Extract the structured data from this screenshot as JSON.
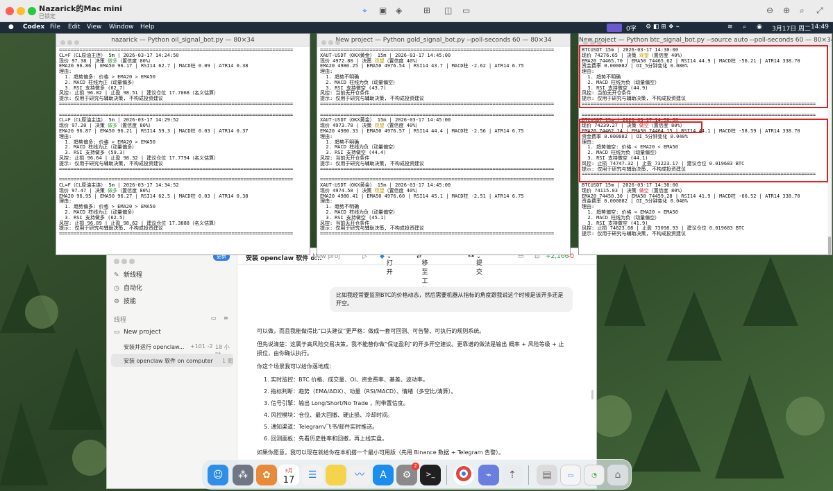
{
  "viewer": {
    "title": "Nazarick的Mac mini",
    "subtitle": "已锁定"
  },
  "menubar": {
    "app": "Codex",
    "items": [
      "File",
      "Edit",
      "View",
      "Window",
      "Help"
    ],
    "status_text": "0字",
    "date": "3月17日 周二",
    "time": "14:49"
  },
  "terminals": [
    {
      "title": "nazarick — Python oil_signal_bot.py — 80×34",
      "lines": [
        [
          [
            "================================================================================",
            "n"
          ]
        ],
        [
          [
            "CL=F（CL原油主连） 5m | 2026-03-17 14:24:50",
            "n"
          ]
        ],
        [
          [
            "现价 97.38 | 决策 ",
            "n"
          ],
          [
            "做多",
            "g"
          ],
          [
            "（置信度 80%）",
            "n"
          ]
        ],
        [
          [
            "EMA20 96.86 | EMA50 96.17 | RSI14 62.7 | MACD柱 0.09 | ATR14 0.38",
            "n"
          ]
        ],
        [
          [
            "理由:",
            "n"
          ]
        ],
        [
          [
            "  1. 趋势偏多: 价格 > EMA20 > EMA50",
            "n"
          ]
        ],
        [
          [
            "  2. MACD 柱线为正（动量偏多）",
            "n"
          ]
        ],
        [
          [
            "  3. RSI 支持做多 (62.7)",
            "n"
          ]
        ],
        [
          [
            "风控: 止损 96.82 | 止盈 98.51 | 建议仓位 17.7068（名义估算）",
            "n"
          ]
        ],
        [
          [
            "提示: 仅用于研究与辅助决策, 不构成投资建议",
            "n"
          ]
        ],
        [
          [
            "================================================================================",
            "n"
          ]
        ],
        [
          [
            "",
            "n"
          ]
        ],
        [
          [
            "================================================================================",
            "n"
          ]
        ],
        [
          [
            "CL=F（CL原油主连） 5m | 2026-03-17 14:29:52",
            "n"
          ]
        ],
        [
          [
            "现价 97.20 | 决策 ",
            "n"
          ],
          [
            "做多",
            "g"
          ],
          [
            "（置信度 80%）",
            "n"
          ]
        ],
        [
          [
            "EMA20 96.87 | EMA50 96.21 | RSI14 59.3 | MACD柱 0.03 | ATR14 0.37",
            "n"
          ]
        ],
        [
          [
            "理由:",
            "n"
          ]
        ],
        [
          [
            "  1. 趋势偏多: 价格 > EMA20 > EMA50",
            "n"
          ]
        ],
        [
          [
            "  2. MACD 柱线为正（动量偏多）",
            "n"
          ]
        ],
        [
          [
            "  3. RSI 支持做多 (59.3)",
            "n"
          ]
        ],
        [
          [
            "风控: 止损 96.64 | 止盈 98.32 | 建议仓位 17.7794（名义估算）",
            "n"
          ]
        ],
        [
          [
            "提示: 仅用于研究与辅助决策, 不构成投资建议",
            "n"
          ]
        ],
        [
          [
            "================================================================================",
            "n"
          ]
        ],
        [
          [
            "",
            "n"
          ]
        ],
        [
          [
            "================================================================================",
            "n"
          ]
        ],
        [
          [
            "CL=F（CL原油主连） 5m | 2026-03-17 14:34:52",
            "n"
          ]
        ],
        [
          [
            "现价 97.47 | 决策 ",
            "n"
          ],
          [
            "做多",
            "g"
          ],
          [
            "（置信度 80%）",
            "n"
          ]
        ],
        [
          [
            "EMA20 96.95 | EMA50 96.27 | RSI14 62.5 | MACD柱 0.03 | ATR14 0.38",
            "n"
          ]
        ],
        [
          [
            "理由:",
            "n"
          ]
        ],
        [
          [
            "  1. 趋势偏多: 价格 > EMA20 > EMA50",
            "n"
          ]
        ],
        [
          [
            "  2. MACD 柱线为正（动量偏多）",
            "n"
          ]
        ],
        [
          [
            "  3. RSI 支持做多 (62.5)",
            "n"
          ]
        ],
        [
          [
            "风控: 止损 96.89 | 止盈 98.62 | 建议仓位 17.3888（名义估算）",
            "n"
          ]
        ],
        [
          [
            "提示: 仅用于研究与辅助决策, 不构成投资建议",
            "n"
          ]
        ],
        [
          [
            "================================================================================",
            "n"
          ]
        ]
      ]
    },
    {
      "title": "New project — Python gold_signal_bot.py --poll-seconds 60 — 80×34",
      "lines": [
        [
          [
            "================================================================================",
            "n"
          ]
        ],
        [
          [
            "XAUT-USDT（OKX黄金） 15m | 2026-03-17 14:45:00",
            "n"
          ]
        ],
        [
          [
            "现价 4972.80 | 决策 ",
            "n"
          ],
          [
            "观望",
            "y"
          ],
          [
            "（置信度 40%）",
            "n"
          ]
        ],
        [
          [
            "EMA20 4980.25 | EMA50 4976.54 | RSI14 43.7 | MACD柱 -2.62 | ATR14 6.75",
            "n"
          ]
        ],
        [
          [
            "理由:",
            "n"
          ]
        ],
        [
          [
            "  1. 趋势不明确",
            "n"
          ]
        ],
        [
          [
            "  2. MACD 柱线为负（动量偏空）",
            "n"
          ]
        ],
        [
          [
            "  3. RSI 支持做空 (43.7)",
            "n"
          ]
        ],
        [
          [
            "风控: 当前无开仓条件",
            "n"
          ]
        ],
        [
          [
            "提示: 仅用于研究与辅助决策, 不构成投资建议",
            "n"
          ]
        ],
        [
          [
            "================================================================================",
            "n"
          ]
        ],
        [
          [
            "",
            "n"
          ]
        ],
        [
          [
            "================================================================================",
            "n"
          ]
        ],
        [
          [
            "XAUT-USDT（OKX黄金） 15m | 2026-03-17 14:45:00",
            "n"
          ]
        ],
        [
          [
            "现价 4973.70 | 决策 ",
            "n"
          ],
          [
            "观望",
            "y"
          ],
          [
            "（置信度 40%）",
            "n"
          ]
        ],
        [
          [
            "EMA20 4980.33 | EMA50 4976.57 | RSI14 44.4 | MACD柱 -2.56 | ATR14 6.75",
            "n"
          ]
        ],
        [
          [
            "理由:",
            "n"
          ]
        ],
        [
          [
            "  1. 趋势不明确",
            "n"
          ]
        ],
        [
          [
            "  2. MACD 柱线为负（动量偏空）",
            "n"
          ]
        ],
        [
          [
            "  3. RSI 支持做空 (44.4)",
            "n"
          ]
        ],
        [
          [
            "风控: 当前无开仓条件",
            "n"
          ]
        ],
        [
          [
            "提示: 仅用于研究与辅助决策, 不构成投资建议",
            "n"
          ]
        ],
        [
          [
            "================================================================================",
            "n"
          ]
        ],
        [
          [
            "",
            "n"
          ]
        ],
        [
          [
            "================================================================================",
            "n"
          ]
        ],
        [
          [
            "XAUT-USDT（OKX黄金） 15m | 2026-03-17 14:45:00",
            "n"
          ]
        ],
        [
          [
            "现价 4974.50 | 决策 ",
            "n"
          ],
          [
            "观望",
            "y"
          ],
          [
            "（置信度 40%）",
            "n"
          ]
        ],
        [
          [
            "EMA20 4980.41 | EMA50 4976.60 | RSI14 45.1 | MACD柱 -2.51 | ATR14 6.75",
            "n"
          ]
        ],
        [
          [
            "理由:",
            "n"
          ]
        ],
        [
          [
            "  1. 趋势不明确",
            "n"
          ]
        ],
        [
          [
            "  2. MACD 柱线为负（动量偏空）",
            "n"
          ]
        ],
        [
          [
            "  3. RSI 支持做空 (45.1)",
            "n"
          ]
        ],
        [
          [
            "风控: 当前无开仓条件",
            "n"
          ]
        ],
        [
          [
            "提示: 仅用于研究与辅助决策, 不构成投资建议",
            "n"
          ]
        ],
        [
          [
            "================================================================================",
            "n"
          ]
        ]
      ]
    },
    {
      "title": "New project — Python btc_signal_bot.py --source auto --poll-seconds 60 — 80×34",
      "lines": [
        [
          [
            "BTCUSDT 15m | 2026-03-17 14:30:00",
            "n"
          ]
        ],
        [
          [
            "现价 74276.65 | 决策 ",
            "n"
          ],
          [
            "观望",
            "y"
          ],
          [
            "（置信度 40%）",
            "n"
          ]
        ],
        [
          [
            "EMA20 74465.70 | EMA50 74465.62 | RSI14 44.9 | MACD柱 -56.21 | ATR14 338.70",
            "n"
          ]
        ],
        [
          [
            "资金费率 0.000082 | OI_5分钟变化 0.080%",
            "n"
          ]
        ],
        [
          [
            "理由:",
            "n"
          ]
        ],
        [
          [
            "  1. 趋势不明确",
            "n"
          ]
        ],
        [
          [
            "  2. MACD 柱线为负（动量偏空）",
            "n"
          ]
        ],
        [
          [
            "  3. RSI 支持做空 (44.9)",
            "n"
          ]
        ],
        [
          [
            "风控: 当前无开仓条件",
            "n"
          ]
        ],
        [
          [
            "提示: 仅用于研究与辅助决策, 不构成投资建议",
            "n"
          ]
        ],
        [
          [
            "================================================================================",
            "n"
          ]
        ],
        [
          [
            "",
            "n"
          ]
        ],
        [
          [
            "================================================================================",
            "n"
          ]
        ],
        [
          [
            "BTCUSDT 15m | 2026-03-17 14:30:00",
            "n"
          ]
        ],
        [
          [
            "现价 74239.27 | 决策 ",
            "n"
          ],
          [
            "做空",
            "r"
          ],
          [
            "（置信度 80%）",
            "n"
          ]
        ],
        [
          [
            "EMA20 74462.14 | EMA50 74464.15 | RSI14 44.1 | MACD柱 -58.59 | ATR14 338.70",
            "n"
          ]
        ],
        [
          [
            "资金费率 0.000082 | OI_5分钟变化 0.040%",
            "n"
          ]
        ],
        [
          [
            "理由:",
            "n"
          ]
        ],
        [
          [
            "  1. 趋势偏空: 价格 < EMA20 < EMA50",
            "n"
          ]
        ],
        [
          [
            "  2. MACD 柱线为负（动量偏空）",
            "n"
          ]
        ],
        [
          [
            "  3. RSI 支持做空 (44.1)",
            "n"
          ]
        ],
        [
          [
            "风控: 止损 74747.32 | 止盈 73223.17 | 建议仓位 0.019683 BTC",
            "n"
          ]
        ],
        [
          [
            "提示: 仅用于研究与辅助决策, 不构成投资建议",
            "n"
          ]
        ],
        [
          [
            "================================================================================",
            "n"
          ]
        ],
        [
          [
            "",
            "n"
          ]
        ],
        [
          [
            "BTCUSDT 15m | 2026-03-17 14:30:00",
            "n"
          ]
        ],
        [
          [
            "现价 74115.03 | 决策 ",
            "n"
          ],
          [
            "做空",
            "r"
          ],
          [
            "（置信度 80%）",
            "n"
          ]
        ],
        [
          [
            "EMA20 74450.30 | EMA50 74459.28 | RSI14 41.9 | MACD柱 -66.52 | ATR14 338.70",
            "n"
          ]
        ],
        [
          [
            "资金费率 0.000082 | OI_5分钟变化 0.040%",
            "n"
          ]
        ],
        [
          [
            "理由:",
            "n"
          ]
        ],
        [
          [
            "  1. 趋势偏空: 价格 < EMA20 < EMA50",
            "n"
          ]
        ],
        [
          [
            "  2. MACD 柱线为负（动量偏空）",
            "n"
          ]
        ],
        [
          [
            "  3. RSI 支持做空 (41.9)",
            "n"
          ]
        ],
        [
          [
            "风控: 止损 74623.08 | 止盈 73098.93 | 建议仓位 0.019683 BTC",
            "n"
          ]
        ],
        [
          [
            "提示: 仅用于研究与辅助决策, 不构成投资建议",
            "n"
          ]
        ]
      ]
    }
  ],
  "app": {
    "update_button": "更新",
    "nav": [
      {
        "icon": "compose-icon",
        "label": "新线程"
      },
      {
        "icon": "clock-icon",
        "label": "自动化"
      },
      {
        "icon": "skills-icon",
        "label": "技能"
      }
    ],
    "threads_header": "线程",
    "project": "New project",
    "threads": [
      {
        "title": "安装并运行 openclaw...",
        "diff": "+101 -2",
        "age": "18 小时"
      },
      {
        "title": "安装 openclaw 软件 on computer",
        "diff": "",
        "age": "1 周"
      }
    ],
    "header": {
      "title": "安装 openclaw 软件 o...",
      "project": "New proj",
      "open_label": "打开",
      "move_label": "移至工作树",
      "commit_label": "提交",
      "diff_add": "+2,166",
      "diff_del": "-0"
    },
    "chat": {
      "user_message": "比如我经常要监测BTC的价格动态，然后需要机器从指标的角度跟我说这个时候是该开多还是开空。",
      "reply": [
        "可以做，而且我能做得比“口头建议”更严格：做成一套可回测、可告警、可执行的规则系统。",
        "但先说清楚：这属于高风险交易决策，我不能替你做“保证盈利”的开多开空建议。更靠谱的做法是输出 概率 + 风险等级 + 止",
        "损位，由你确认执行。",
        "你这个场景我可以给你落地成：",
        "1. 实时监控：BTC 价格、成交量、OI、资金费率、基差、波动率。",
        "2. 指标判断：趋势（EMA/ADX）、动量（RSI/MACD）、情绪（多空比/清算）。",
        "3. 信号引擎：输出 Long/Short/No Trade ，附带置信度。",
        "4. 风控模块：仓位、最大回撤、硬止损、冷却时间。",
        "5. 通知渠道：Telegram/飞书/邮件实时推送。",
        "6. 回测面板：先看历史胜率和回撤，再上线实盘。",
        "如果你愿意，我可以现在就给你在本机搭一个最小可用版（先用 Binance 数据 + Telegram 告警）。"
      ]
    }
  },
  "dock": {
    "calendar_month": "3月",
    "calendar_day": "17",
    "settings_badge": "2",
    "apps": [
      {
        "icon": "finder-icon",
        "color": "#2f8ee8"
      },
      {
        "icon": "launchpad-icon",
        "color": "#6f7785"
      },
      {
        "icon": "photos-icon",
        "color": "#e88a3a"
      },
      {
        "icon": "calendar-icon",
        "color": "#ffffff"
      },
      {
        "icon": "reminders-icon",
        "color": "#f2f2f2"
      },
      {
        "icon": "notes-icon",
        "color": "#f5d34a"
      },
      {
        "icon": "freeform-icon",
        "color": "#f0f0f0"
      },
      {
        "icon": "appstore-icon",
        "color": "#1b8df0"
      },
      {
        "icon": "settings-icon",
        "color": "#8a8a8a"
      },
      {
        "icon": "terminal-icon",
        "color": "#1f1f1f"
      },
      {
        "icon": "chrome-icon",
        "color": "#ffffff"
      },
      {
        "icon": "remote-icon",
        "color": "#6a7ee0"
      },
      {
        "icon": "rocket-icon",
        "color": "#e8ecef"
      },
      {
        "icon": "archive-icon",
        "color": "#dcdcdc"
      },
      {
        "icon": "window-thumb-icon",
        "color": "#f5f5f5"
      },
      {
        "icon": "chrome-thumb-icon",
        "color": "#f0f0f0"
      },
      {
        "icon": "trash-icon",
        "color": "#d8dde0"
      }
    ]
  }
}
